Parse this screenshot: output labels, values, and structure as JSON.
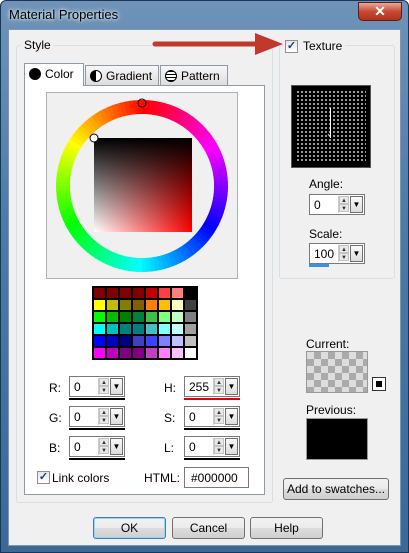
{
  "window": {
    "title": "Material Properties",
    "close_glyph": "✕"
  },
  "style_group": {
    "label": "Style"
  },
  "tabs": [
    {
      "label": "Color",
      "icon": "color-circle-icon"
    },
    {
      "label": "Gradient",
      "icon": "gradient-circle-icon"
    },
    {
      "label": "Pattern",
      "icon": "pattern-globe-icon"
    }
  ],
  "swatch_colors": [
    [
      "#800000",
      "#800000",
      "#800000",
      "#800000",
      "#c00000",
      "#ff4040",
      "#ff8080",
      "#000000"
    ],
    [
      "#ffff00",
      "#c0c000",
      "#808000",
      "#806000",
      "#ff8000",
      "#ffc000",
      "#ffffc0",
      "#404040"
    ],
    [
      "#00ff00",
      "#00c000",
      "#008000",
      "#008040",
      "#40c040",
      "#80ff80",
      "#c0ffc0",
      "#808080"
    ],
    [
      "#00ffff",
      "#00c0c0",
      "#008080",
      "#008080",
      "#40c0c0",
      "#80ffff",
      "#c0ffff",
      "#a0a0a0"
    ],
    [
      "#0000ff",
      "#0000c0",
      "#000080",
      "#4040c0",
      "#4040ff",
      "#8080ff",
      "#c0c0ff",
      "#c0c0c0"
    ],
    [
      "#ff00ff",
      "#c000c0",
      "#800080",
      "#800080",
      "#c040c0",
      "#ff80ff",
      "#ffc0ff",
      "#ffffff"
    ]
  ],
  "rgb": {
    "r_label": "R:",
    "r_value": "0",
    "g_label": "G:",
    "g_value": "0",
    "b_label": "B:",
    "b_value": "0"
  },
  "hsl": {
    "h_label": "H:",
    "h_value": "255",
    "s_label": "S:",
    "s_value": "0",
    "l_label": "L:",
    "l_value": "0"
  },
  "link_colors": {
    "label": "Link colors",
    "checked": true
  },
  "html_field": {
    "label": "HTML:",
    "value": "#000000"
  },
  "texture": {
    "label": "Texture",
    "checked": true
  },
  "angle": {
    "label": "Angle:",
    "value": "0"
  },
  "scale": {
    "label": "Scale:",
    "value": "100"
  },
  "current": {
    "label": "Current:"
  },
  "previous": {
    "label": "Previous:"
  },
  "add_swatches_label": "Add to swatches...",
  "footer": {
    "ok": "OK",
    "cancel": "Cancel",
    "help": "Help"
  },
  "accent_colors": {
    "arrow": "#c0392b",
    "selection_red": "#e00000",
    "scale_bar": "#3a8fe0"
  }
}
